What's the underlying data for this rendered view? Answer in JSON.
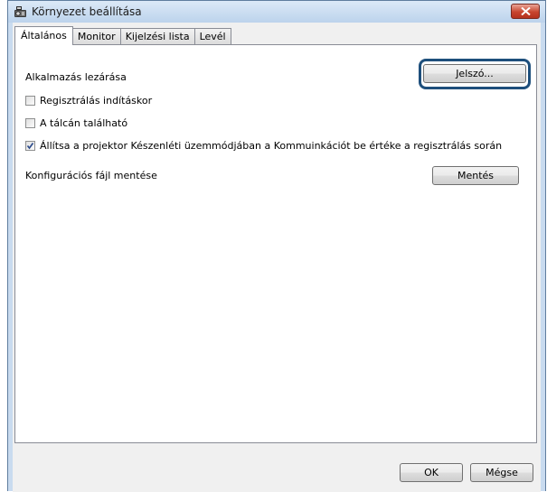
{
  "window": {
    "title": "Környezet beállítása"
  },
  "tabs": [
    {
      "label": "Általános",
      "active": true
    },
    {
      "label": "Monitor",
      "active": false
    },
    {
      "label": "Kijelzési lista",
      "active": false
    },
    {
      "label": "Levél",
      "active": false
    }
  ],
  "general": {
    "lock_label": "Alkalmazás lezárása",
    "password_button": "Jelszó...",
    "register_at_startup": {
      "label": "Regisztrálás indításkor",
      "checked": false
    },
    "in_taskbar": {
      "label": "A tálcán található",
      "checked": false
    },
    "standby_setting": {
      "label": "Állítsa a projektor Készenléti üzemmódjában a Kommuinkációt be értéke a regisztrálás során",
      "checked": true
    },
    "config_save_label": "Konfigurációs fájl mentése",
    "save_button": "Mentés"
  },
  "footer": {
    "ok_label": "OK",
    "cancel_label": "Mégse"
  },
  "colors": {
    "highlight_border": "#1e4f7c",
    "close_button": "#c8452f",
    "titlebar": "#bcd3ec"
  }
}
